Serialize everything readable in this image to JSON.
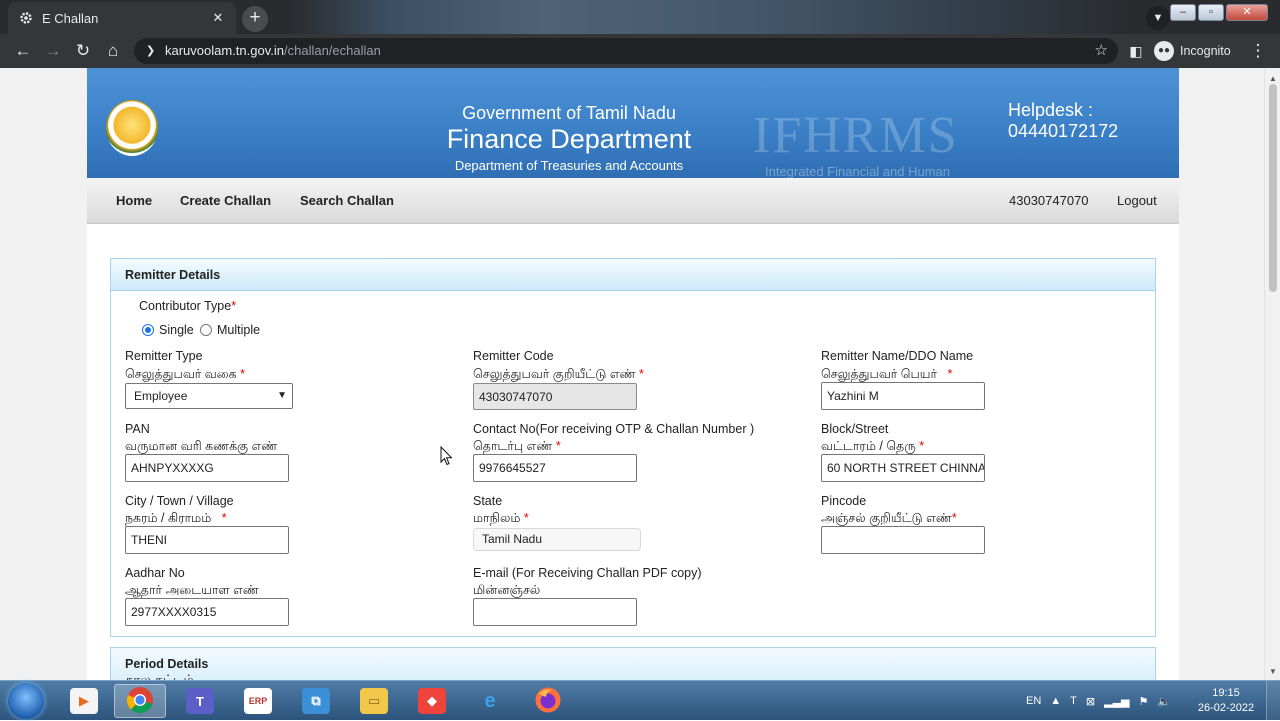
{
  "browser": {
    "tab_title": "E Challan",
    "url_host": "karuvoolam.tn.gov.in",
    "url_path": "/challan/echallan",
    "incognito_label": "Incognito"
  },
  "header": {
    "gov_line": "Government of Tamil Nadu",
    "dept_line": "Finance Department",
    "sub_line": "Department of Treasuries and Accounts",
    "watermark": "IFHRMS",
    "watermark_sub": "Integrated Financial and Human",
    "helpdesk_label": "Helpdesk :",
    "helpdesk_number": "04440172172"
  },
  "nav": {
    "home": "Home",
    "create": "Create Challan",
    "search": "Search Challan",
    "user_id": "43030747070",
    "logout": "Logout"
  },
  "remitter": {
    "section_title": "Remitter Details",
    "contributor_type_label": "Contributor Type",
    "option_single": "Single",
    "option_multiple": "Multiple",
    "selected_option": "Single",
    "remitter_type_en": "Remitter Type",
    "remitter_type_ta": "செலுத்துபவர் வகை",
    "remitter_type_value": "Employee",
    "remitter_code_en": "Remitter Code",
    "remitter_code_ta": "செலுத்துபவர் குறியீட்டு எண்",
    "remitter_code_value": "43030747070",
    "remitter_name_en": "Remitter Name/DDO Name",
    "remitter_name_ta": "செலுத்துபவர் பெயர்",
    "remitter_name_value": "Yazhini M",
    "pan_en": "PAN",
    "pan_ta": "வருமான வரி கணக்கு எண்",
    "pan_value": "AHNPYXXXXG",
    "contact_en": "Contact No(For receiving OTP & Challan Number )",
    "contact_ta": "தொடர்பு எண்",
    "contact_value": "9976645527",
    "block_en": "Block/Street",
    "block_ta": "வட்டாரம் / தெரு",
    "block_value": "60 NORTH STREET CHINNA",
    "city_en": "City / Town / Village",
    "city_ta": "நகரம் / கிராமம்",
    "city_value": "THENI",
    "state_en": "State",
    "state_ta": "மாநிலம்",
    "state_value": "Tamil Nadu",
    "pincode_en": "Pincode",
    "pincode_ta": "அஞ்சல் குறியீட்டு எண்",
    "pincode_value": "",
    "aadhar_en": "Aadhar No",
    "aadhar_ta": "ஆதார் அடையாள எண்",
    "aadhar_value": "2977XXXX0315",
    "email_en": "E-mail (For Receiving Challan PDF copy)",
    "email_ta": "மின்னஞ்சல்",
    "email_value": ""
  },
  "period": {
    "section_title": "Period Details",
    "section_title_ta": "கால கட்டம்"
  },
  "taskbar": {
    "lang": "EN",
    "time": "19:15",
    "date": "26-02-2022"
  }
}
